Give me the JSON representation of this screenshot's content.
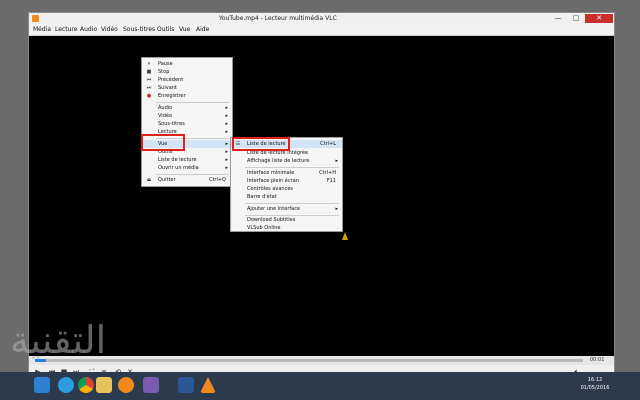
{
  "window": {
    "title": "YouTube.mp4 - Lecteur multimédia VLC",
    "controls": {
      "minimize": "—",
      "maximize": "□",
      "close": "✕"
    }
  },
  "menubar": [
    "Média",
    "Lecture",
    "Audio",
    "Vidéo",
    "Sous-titres",
    "Outils",
    "Vue",
    "Aide"
  ],
  "context_menu": {
    "items": [
      {
        "label": "Pause",
        "icon": "pause-icon",
        "glyph": "⏸"
      },
      {
        "label": "Stop",
        "icon": "stop-icon",
        "glyph": "■"
      },
      {
        "label": "Précédent",
        "icon": "previous-icon",
        "glyph": "⏮"
      },
      {
        "label": "Suivant",
        "icon": "next-icon",
        "glyph": "⏭"
      },
      {
        "label": "Enregistrer",
        "icon": "record-icon",
        "glyph": "●"
      },
      {
        "label": "Audio"
      },
      {
        "label": "Vidéo"
      },
      {
        "label": "Sous-titres"
      },
      {
        "label": "Lecture"
      },
      {
        "label": "Vue"
      },
      {
        "label": "Outils"
      },
      {
        "label": "Liste de lecture"
      },
      {
        "label": "Ouvrir un média"
      },
      {
        "label": "Quitter",
        "shortcut": "Ctrl+Q",
        "icon": "quit-icon",
        "glyph": "⏏"
      }
    ],
    "arrow": "▸"
  },
  "submenu": {
    "items": [
      {
        "label": "Liste de lecture",
        "shortcut": "Ctrl+L"
      },
      {
        "label": "Liste de lecture intégrée"
      },
      {
        "label": "Affichage liste de lecture"
      },
      {
        "label": "Interface minimale",
        "shortcut": "Ctrl+H"
      },
      {
        "label": "Interface plein écran",
        "shortcut": "F11"
      },
      {
        "label": "Contrôles avancés"
      },
      {
        "label": "Barre d'état"
      },
      {
        "label": "Ajouter une interface"
      },
      {
        "label": "Download Subtitles"
      },
      {
        "label": "VLSub Online"
      }
    ]
  },
  "player": {
    "time_end": "00:01",
    "progress": 0.02
  },
  "taskbar": {
    "time": "16:12",
    "date": "01/05/2016"
  },
  "accent": "#e0211b"
}
